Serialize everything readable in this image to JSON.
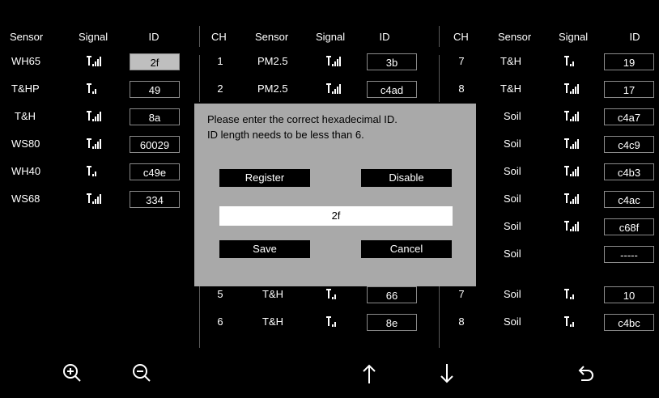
{
  "table": {
    "headers": {
      "col1": {
        "sensor": "Sensor",
        "signal": "Signal",
        "id": "ID"
      },
      "col2": {
        "ch": "CH",
        "sensor": "Sensor",
        "signal": "Signal",
        "id": "ID"
      },
      "col3": {
        "ch": "CH",
        "sensor": "Sensor",
        "signal": "Signal",
        "id": "ID"
      }
    },
    "col1_rows": [
      {
        "sensor": "WH65",
        "signal_bars": 4,
        "id": "2f",
        "selected": true
      },
      {
        "sensor": "T&HP",
        "signal_bars": 2,
        "id": "49"
      },
      {
        "sensor": "T&H",
        "signal_bars": 4,
        "id": "8a"
      },
      {
        "sensor": "WS80",
        "signal_bars": 4,
        "id": "60029"
      },
      {
        "sensor": "WH40",
        "signal_bars": 2,
        "id": "c49e"
      },
      {
        "sensor": "WS68",
        "signal_bars": 4,
        "id": "334"
      }
    ],
    "col2_rows_top": [
      {
        "ch": "1",
        "sensor": "PM2.5",
        "signal_bars": 4,
        "id": "3b"
      },
      {
        "ch": "2",
        "sensor": "PM2.5",
        "signal_bars": 4,
        "id": "c4ad"
      }
    ],
    "col2_rows_bottom": [
      {
        "ch": "5",
        "sensor": "T&H",
        "signal_bars": 2,
        "id": "66"
      },
      {
        "ch": "6",
        "sensor": "T&H",
        "signal_bars": 2,
        "id": "8e"
      }
    ],
    "col3_rows": [
      {
        "ch": "7",
        "sensor": "T&H",
        "signal_bars": 2,
        "id": "19"
      },
      {
        "ch": "8",
        "sensor": "T&H",
        "signal_bars": 4,
        "id": "17"
      },
      {
        "ch": "",
        "sensor": "Soil",
        "signal_bars": 4,
        "id": "c4a7"
      },
      {
        "ch": "",
        "sensor": "Soil",
        "signal_bars": 4,
        "id": "c4c9"
      },
      {
        "ch": "",
        "sensor": "Soil",
        "signal_bars": 4,
        "id": "c4b3"
      },
      {
        "ch": "",
        "sensor": "Soil",
        "signal_bars": 4,
        "id": "c4ac"
      },
      {
        "ch": "",
        "sensor": "Soil",
        "signal_bars": 4,
        "id": "c68f"
      },
      {
        "ch": "",
        "sensor": "Soil",
        "signal_bars": 0,
        "id": "-----"
      },
      {
        "ch": "7",
        "sensor": "Soil",
        "signal_bars": 2,
        "id": "10"
      },
      {
        "ch": "8",
        "sensor": "Soil",
        "signal_bars": 2,
        "id": "c4bc"
      }
    ]
  },
  "dialog": {
    "message_line1": "Please enter the correct hexadecimal ID.",
    "message_line2": "ID length needs to be less than 6.",
    "register_label": "Register",
    "disable_label": "Disable",
    "input_value": "2f",
    "save_label": "Save",
    "cancel_label": "Cancel"
  },
  "toolbar": {
    "icons": [
      "zoom-in-icon",
      "zoom-out-icon",
      "arrow-up-icon",
      "arrow-down-icon",
      "back-icon"
    ]
  },
  "colors": {
    "background": "#000000",
    "dialog": "#a9a9a9",
    "selected_id": "#bfbfbf",
    "button": "#000000"
  }
}
